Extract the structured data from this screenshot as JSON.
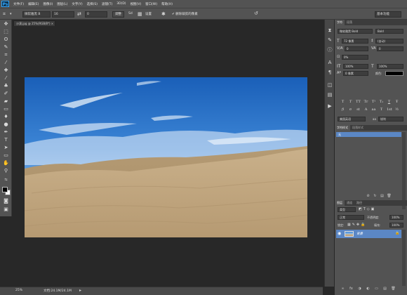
{
  "app": {
    "logo": "Ps"
  },
  "menu": [
    "文件(F)",
    "编辑(E)",
    "图像(I)",
    "图层(L)",
    "文字(Y)",
    "选择(S)",
    "滤镜(T)",
    "3D(D)",
    "视图(V)",
    "窗口(W)",
    "帮助(H)"
  ],
  "options": {
    "font_family": "微软雅黑 B",
    "font_size": "16",
    "size_value": "0",
    "button1": "调整",
    "button1_suffix": "Sd",
    "button2": "设置",
    "checkbox_label": "删除裁剪的像素",
    "workspace": "基本功能"
  },
  "document": {
    "tab_title": "沙漠.jpg @ 25%(RGB/8*) ×",
    "zoom": "25%",
    "doc_info": "文档:24.1M/24.1M"
  },
  "character_panel": {
    "tabs": [
      "字符",
      "段落"
    ],
    "font_family": "微软雅黑 Bold",
    "font_style": "Bold",
    "font_size": "72 像素",
    "leading": "(自动)",
    "kerning": "0",
    "tracking": "0",
    "scale_pct": "0%",
    "vscale": "100%",
    "hscale": "100%",
    "baseline": "0 像素",
    "color_label": "颜色:",
    "language": "美国英语",
    "aa_label": "aa",
    "antialias": "锐利",
    "text_style_glyphs": [
      "T",
      "T",
      "TT",
      "Tr",
      "T¹",
      "T₁",
      "T",
      "Ŧ"
    ],
    "ligature_glyphs": [
      "fi",
      "σ",
      "st",
      "A",
      "aa",
      "T",
      "1st",
      "½"
    ]
  },
  "paragraph_panel": {
    "tabs": [
      "字符样式",
      "段落样式"
    ],
    "item": "无"
  },
  "layers_panel": {
    "tabs": [
      "图层",
      "通道",
      "路径"
    ],
    "kind_filter": "类型",
    "blend_mode": "正常",
    "opacity_label": "不透明度:",
    "opacity": "100%",
    "lock_label": "锁定:",
    "fill_label": "填充:",
    "fill": "100%",
    "layer_name": "背景"
  },
  "colors": {
    "accent": "#31a8ff",
    "panel": "#535353",
    "canvas_bg": "#282828"
  }
}
